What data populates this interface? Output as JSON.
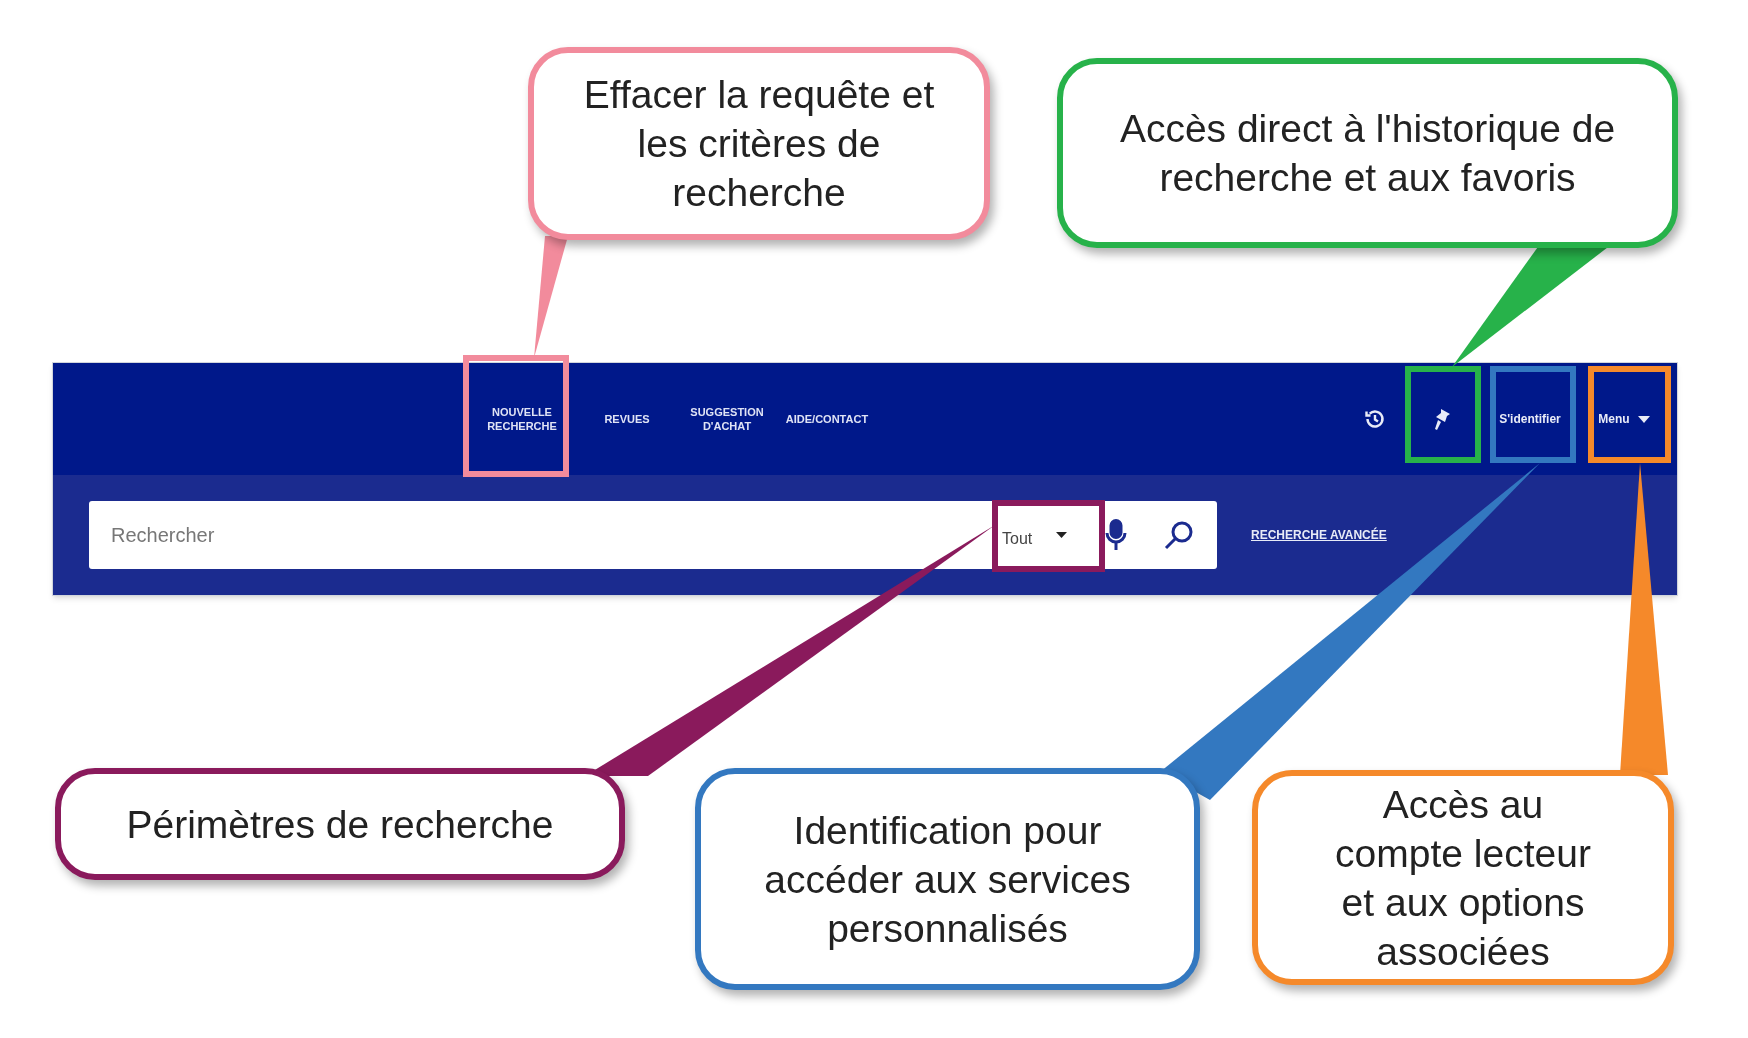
{
  "nav": {
    "items": [
      {
        "label": "NOUVELLE RECHERCHE"
      },
      {
        "label": "REVUES"
      },
      {
        "label": "SUGGESTION D'ACHAT"
      },
      {
        "label": "AIDE/CONTACT"
      }
    ],
    "login": "S'identifier",
    "menu": "Menu"
  },
  "search": {
    "placeholder": "Rechercher",
    "scope": "Tout",
    "advanced_link": "RECHERCHE AVANCÉE"
  },
  "callouts": [
    {
      "text": "Effacer la requête et les critères de recherche",
      "color": "#f28b9c"
    },
    {
      "text": "Accès direct à l'historique de recherche et aux favoris",
      "color": "#27b24a"
    },
    {
      "text": "Périmètres de recherche",
      "color": "#8a1a5c"
    },
    {
      "text": "Identification pour accéder aux services personnalisés",
      "color": "#3378c0"
    },
    {
      "text": "Accès au compte lecteur et aux options associées",
      "color": "#f5892a"
    }
  ]
}
